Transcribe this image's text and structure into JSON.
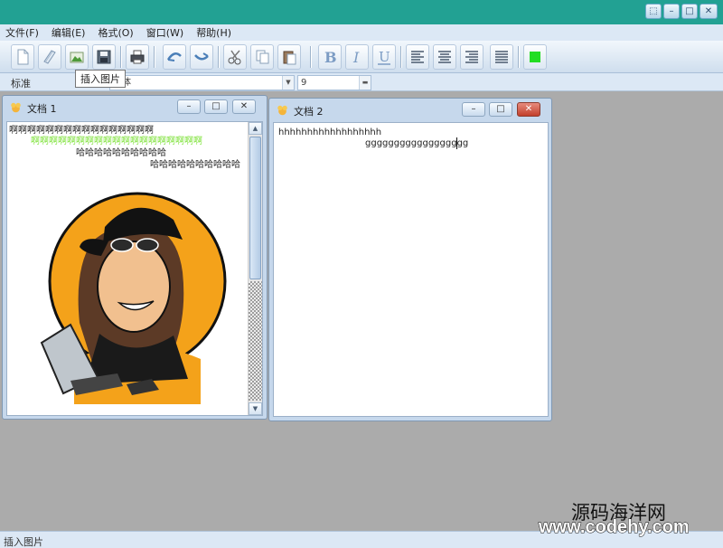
{
  "menu": [
    "文件(F)",
    "编辑(E)",
    "格式(O)",
    "窗口(W)",
    "帮助(H)"
  ],
  "system_buttons": [
    "restore",
    "minimize",
    "maximize",
    "close"
  ],
  "toolbar": {
    "tooltip": "插入图片",
    "buttons": [
      "new-document-icon",
      "open-document-icon",
      "insert-image-icon",
      "save-icon",
      "print-icon",
      "undo-icon",
      "redo-icon",
      "cut-icon",
      "copy-icon",
      "paste-icon",
      "bold-icon",
      "italic-icon",
      "underline-icon",
      "align-left-icon",
      "align-center-icon",
      "align-right-icon",
      "justify-icon",
      "text-color-icon"
    ],
    "color_swatch": "#22dd22"
  },
  "format_bar": {
    "style_label": "标准",
    "font_name": "宋体",
    "font_size": "9"
  },
  "windows": [
    {
      "title": "文档 1",
      "lines": [
        {
          "text": "啊啊啊啊啊啊啊啊啊啊啊啊啊啊啊啊",
          "color": "#222222"
        },
        {
          "text": "啊啊啊啊啊啊啊啊啊啊啊啊啊啊啊啊啊啊啊",
          "color": "#7ee23a"
        },
        {
          "text": "哈哈哈哈哈哈哈哈哈哈",
          "color": "#222222"
        },
        {
          "text": "哈哈哈哈哈哈哈哈哈哈",
          "color": "#222222"
        }
      ],
      "image": "cartoon-avatar-image"
    },
    {
      "title": "文档 2",
      "lines": [
        {
          "text": "hhhhhhhhhhhhhhhhhh",
          "color": "#222222"
        },
        {
          "text": "gggggggggggggggggg",
          "color": "#222222"
        }
      ]
    }
  ],
  "status_text": "插入图片",
  "watermark": {
    "title": "源码海洋网",
    "url": "www.codehy.com"
  },
  "colors": {
    "title_bar": "#22a193",
    "chrome": "#dce8f5",
    "workspace": "#ababab",
    "close_button": "#c2402c"
  }
}
